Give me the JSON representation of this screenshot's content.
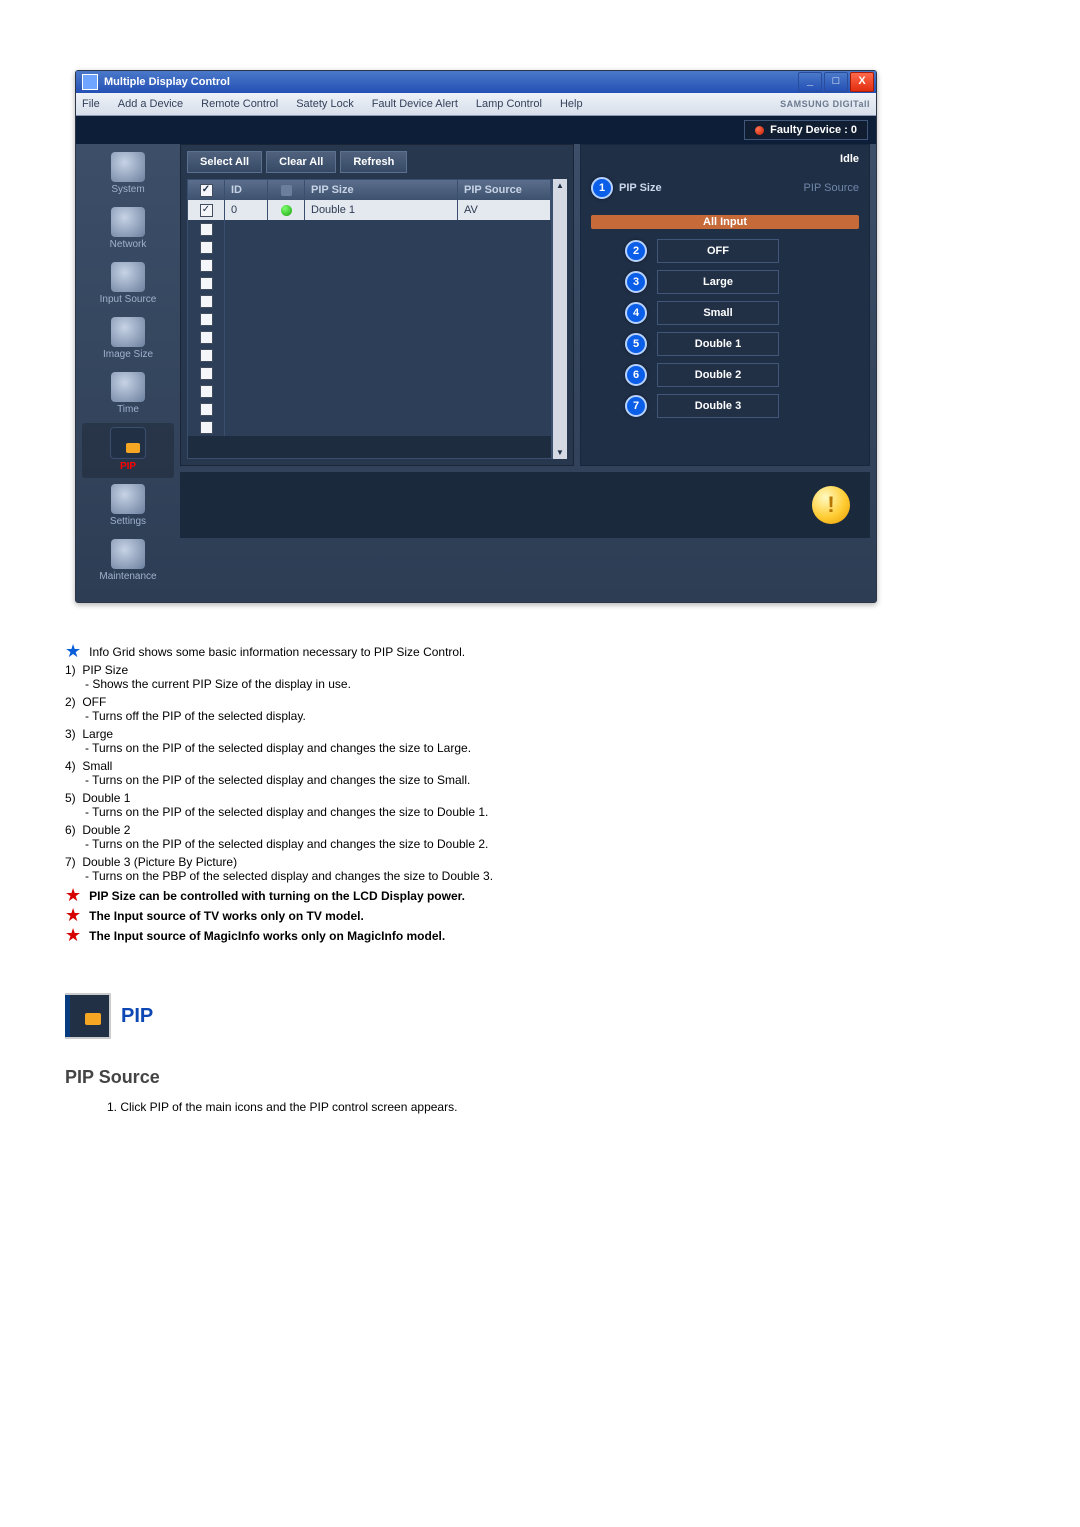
{
  "app": {
    "title": "Multiple Display Control",
    "menus": [
      "File",
      "Add a Device",
      "Remote Control",
      "Satety Lock",
      "Fault Device Alert",
      "Lamp Control",
      "Help"
    ],
    "brand": "SAMSUNG DIGITall",
    "faulty_label": "Faulty Device : 0",
    "idle_label": "Idle",
    "window_controls": {
      "min": "_",
      "max": "□",
      "close": "X"
    }
  },
  "sidebar": {
    "items": [
      {
        "label": "System",
        "name": "sidebar-item-system"
      },
      {
        "label": "Network",
        "name": "sidebar-item-network"
      },
      {
        "label": "Input Source",
        "name": "sidebar-item-input-source"
      },
      {
        "label": "Image Size",
        "name": "sidebar-item-image-size"
      },
      {
        "label": "Time",
        "name": "sidebar-item-time"
      },
      {
        "label": "PIP",
        "name": "sidebar-item-pip"
      },
      {
        "label": "Settings",
        "name": "sidebar-item-settings"
      },
      {
        "label": "Maintenance",
        "name": "sidebar-item-maintenance"
      }
    ]
  },
  "toolbar": {
    "select_all": "Select All",
    "clear_all": "Clear All",
    "refresh": "Refresh"
  },
  "grid": {
    "headers": {
      "chk": "",
      "id": "ID",
      "status": "",
      "psize": "PIP Size",
      "psource": "PIP Source"
    },
    "rows": [
      {
        "checked": true,
        "id": "0",
        "pip_size": "Double 1",
        "pip_source": "AV"
      }
    ]
  },
  "right": {
    "head_left": "PIP Size",
    "head_right": "PIP Source",
    "all_input": "All Input",
    "buttons": [
      "OFF",
      "Large",
      "Small",
      "Double 1",
      "Double 2",
      "Double 3"
    ]
  },
  "explain": {
    "star_intro": "Info Grid shows some basic information necessary to PIP Size Control.",
    "items": [
      {
        "n": "1)",
        "title": "PIP Size",
        "desc": "- Shows the current PIP Size of the display in use."
      },
      {
        "n": "2)",
        "title": "OFF",
        "desc": "- Turns off the PIP of the selected display."
      },
      {
        "n": "3)",
        "title": "Large",
        "desc": "- Turns on the PIP of the selected display and changes the size to Large."
      },
      {
        "n": "4)",
        "title": "Small",
        "desc": "- Turns on the PIP of the selected display and changes the size to Small."
      },
      {
        "n": "5)",
        "title": "Double 1",
        "desc": "- Turns on the PIP of the selected display and changes the size to Double 1."
      },
      {
        "n": "6)",
        "title": "Double 2",
        "desc": "- Turns on the PIP of the selected display and changes the size to Double 2."
      },
      {
        "n": "7)",
        "title": "Double 3 (Picture By Picture)",
        "desc": "- Turns on the PBP of the selected display and changes the size to Double 3."
      }
    ],
    "red_stars": [
      "PIP Size can be controlled with turning on the LCD Display power.",
      "The Input source of TV works only on TV model.",
      "The Input source of MagicInfo works only on MagicInfo model."
    ]
  },
  "pip_section": {
    "header": "PIP",
    "sub_heading": "PIP Source",
    "step1": "1. Click PIP of the main icons and the PIP control screen appears."
  }
}
